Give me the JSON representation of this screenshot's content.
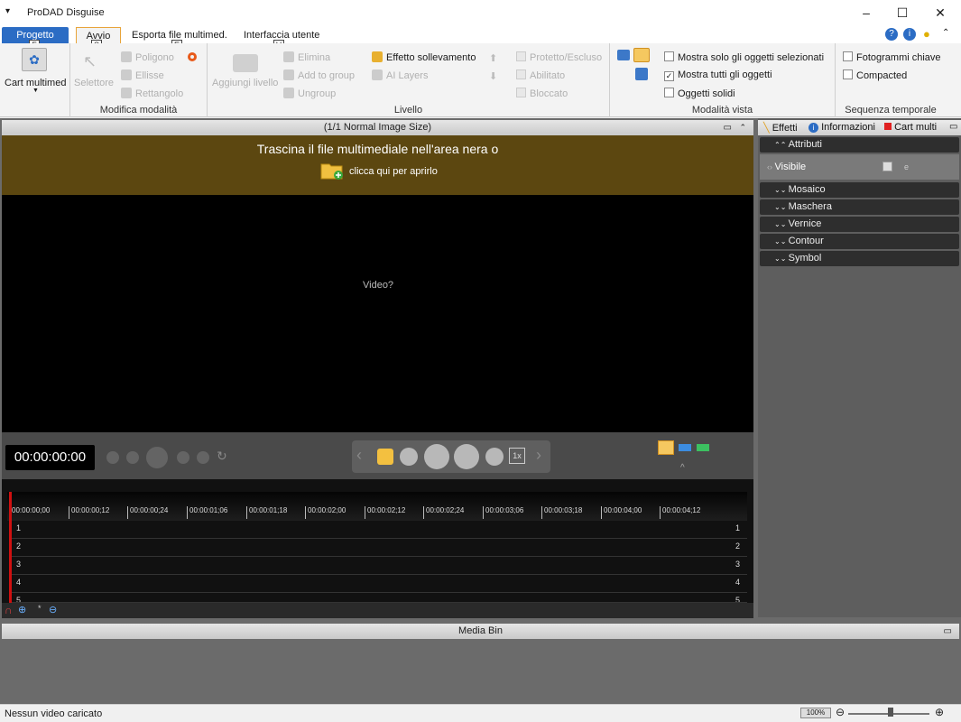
{
  "app": {
    "title": "ProDAD Disguise"
  },
  "ribbon_tabs": [
    {
      "label": "Progetto",
      "keytip": "F"
    },
    {
      "label": "Avvio",
      "keytip": "S"
    },
    {
      "label": "Esporta file multimed.",
      "keytip": "E"
    },
    {
      "label": "Interfaccia utente",
      "keytip": "U"
    }
  ],
  "groups": {
    "cart": {
      "label": "Cart multimed"
    },
    "modifica": {
      "label": "Modifica modalità",
      "selettore": "Selettore",
      "poligono": "Poligono",
      "ellisse": "Ellisse",
      "rettangolo": "Rettangolo"
    },
    "livello": {
      "label": "Livello",
      "aggiungi": "Aggiungi livello",
      "elimina": "Elimina",
      "add_to_group": "Add to group",
      "ungroup": "Ungroup",
      "effetto": "Effetto sollevamento",
      "ai_layers": "AI Layers",
      "protetto": "Protetto/Escluso",
      "abilitato": "Abilitato",
      "bloccato": "Bloccato"
    },
    "vista": {
      "label": "Modalità vista",
      "solo_selezionati": "Mostra solo gli oggetti selezionati",
      "tutti": "Mostra tutti gli oggetti",
      "solidi": "Oggetti solidi",
      "tutti_checked": true
    },
    "sequenza": {
      "label": "Sequenza temporale",
      "fotogrammi": "Fotogrammi chiave",
      "compacted": "Compacted"
    }
  },
  "viewer": {
    "header": "(1/1  Normal Image Size)",
    "drop_line1": "Trascina il file multimediale nell'area nera o",
    "drop_line2": "clicca qui per aprirlo",
    "video_text": "Video?"
  },
  "controls": {
    "timecode": "00:00:00:00",
    "speed": "1x"
  },
  "timeline": {
    "ticks": [
      "00:00:00;00",
      "00:00:00;12",
      "00:00:00;24",
      "00:00:01;06",
      "00:00:01;18",
      "00:00:02;00",
      "00:00:02;12",
      "00:00:02;24",
      "00:00:03;06",
      "00:00:03;18",
      "00:00:04;00",
      "00:00:04;12"
    ],
    "tracks": [
      "1",
      "2",
      "3",
      "4",
      "5"
    ]
  },
  "right_panel": {
    "tabs": [
      "Effetti",
      "Informazioni",
      "Cart multi"
    ],
    "sections": [
      "Attributi",
      "Mosaico",
      "Maschera",
      "Vernice",
      "Contour",
      "Symbol"
    ],
    "visible_label": "Visibile"
  },
  "media_bin": {
    "title": "Media Bin"
  },
  "status": {
    "text": "Nessun video caricato",
    "zoom": "100%"
  },
  "colors": {
    "accent": "#2b6cc4",
    "drop_bar": "#5c4710",
    "playhead": "#d01010"
  }
}
